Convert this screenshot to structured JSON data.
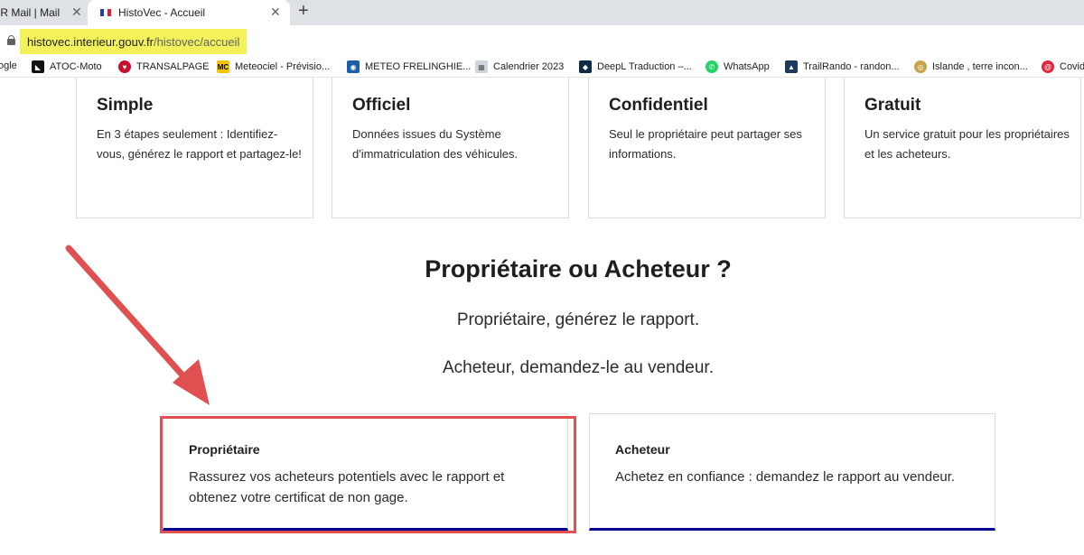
{
  "tabs": [
    {
      "label": "FR Mail | Mail"
    },
    {
      "label": "HistoVec - Accueil"
    }
  ],
  "newtab": "+",
  "close_glyph": "✕",
  "address": {
    "host": "histovec.interieur.gouv.fr",
    "path": "/histovec/accueil"
  },
  "bookmarks": [
    {
      "label": "ogle",
      "icon": "google-icon"
    },
    {
      "label": "ATOC-Moto",
      "icon": "atoc-icon"
    },
    {
      "label": "TRANSALPAGE",
      "icon": "heart-icon"
    },
    {
      "label": "Meteociel - Prévisio...",
      "icon": "mc-icon"
    },
    {
      "label": "METEO FRELINGHIE...",
      "icon": "meteo-icon"
    },
    {
      "label": "Calendrier 2023",
      "icon": "calendar-icon"
    },
    {
      "label": "DeepL Traduction –...",
      "icon": "deepl-icon"
    },
    {
      "label": "WhatsApp",
      "icon": "whatsapp-icon"
    },
    {
      "label": "TrailRando - randon...",
      "icon": "trailrando-icon"
    },
    {
      "label": "Islande , terre incon...",
      "icon": "islande-icon"
    },
    {
      "label": "Covid",
      "icon": "covid-icon"
    }
  ],
  "features": [
    {
      "title": "Simple",
      "text": "En 3 étapes seulement : Identifiez-vous, générez le rapport et partagez-le!"
    },
    {
      "title": "Officiel",
      "text": "Données issues du Système d'immatriculation des véhicules."
    },
    {
      "title": "Confidentiel",
      "text": "Seul le propriétaire peut partager ses informations."
    },
    {
      "title": "Gratuit",
      "text": "Un service gratuit pour les propriétaires et les acheteurs."
    }
  ],
  "section": {
    "title": "Propriétaire ou Acheteur ?",
    "line1": "Propriétaire, générez le rapport.",
    "line2": "Acheteur, demandez-le au vendeur."
  },
  "choices": [
    {
      "title": "Propriétaire",
      "text": "Rassurez vos acheteurs potentiels avec le rapport et obtenez votre certificat de non gage."
    },
    {
      "title": "Acheteur",
      "text": "Achetez en confiance : demandez le rapport au vendeur."
    }
  ],
  "colors": {
    "accent": "#000091",
    "annotation": "#e05050",
    "url_highlight": "#f4f25a"
  }
}
